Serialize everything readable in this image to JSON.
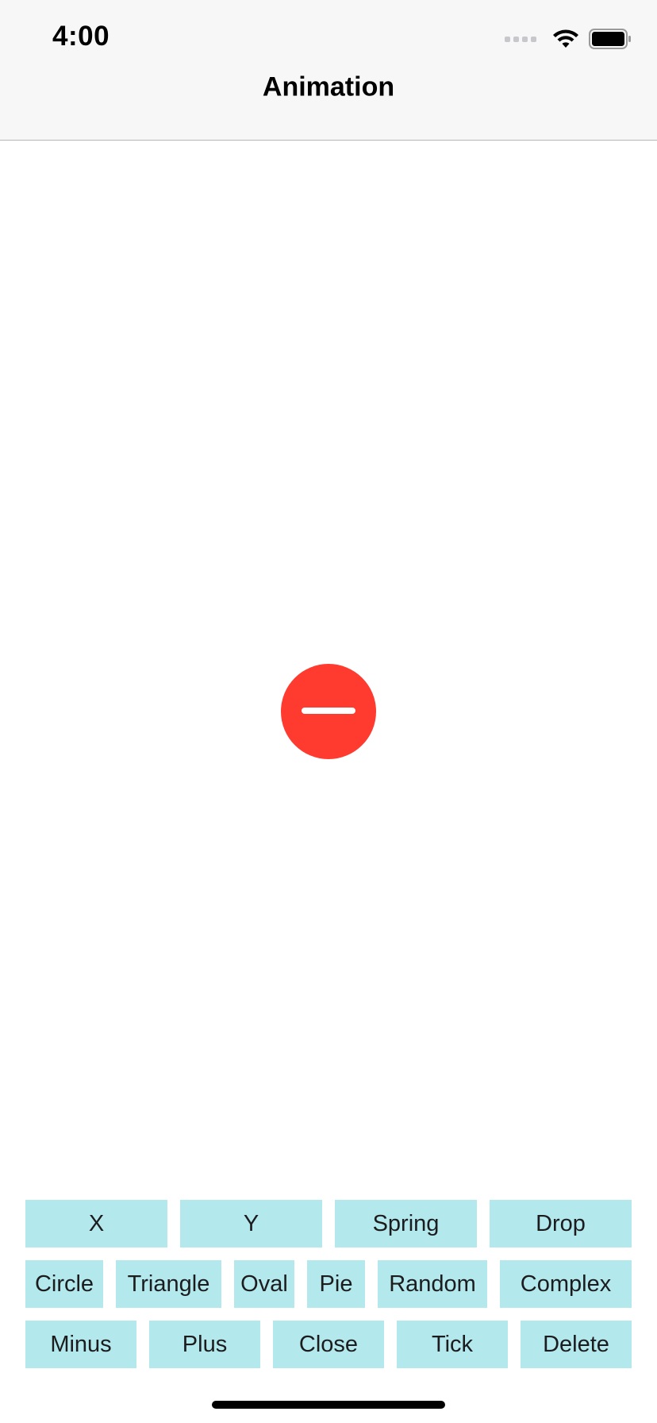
{
  "status_bar": {
    "time": "4:00"
  },
  "nav": {
    "title": "Animation"
  },
  "shape": {
    "icon": "minus-circle-icon",
    "color": "#ff3b30"
  },
  "colors": {
    "button_bg": "#b3e8ec",
    "accent_red": "#ff3b30"
  },
  "buttons": {
    "row1": [
      "X",
      "Y",
      "Spring",
      "Drop"
    ],
    "row2": [
      "Circle",
      "Triangle",
      "Oval",
      "Pie",
      "Random",
      "Complex"
    ],
    "row3": [
      "Minus",
      "Plus",
      "Close",
      "Tick",
      "Delete"
    ]
  }
}
